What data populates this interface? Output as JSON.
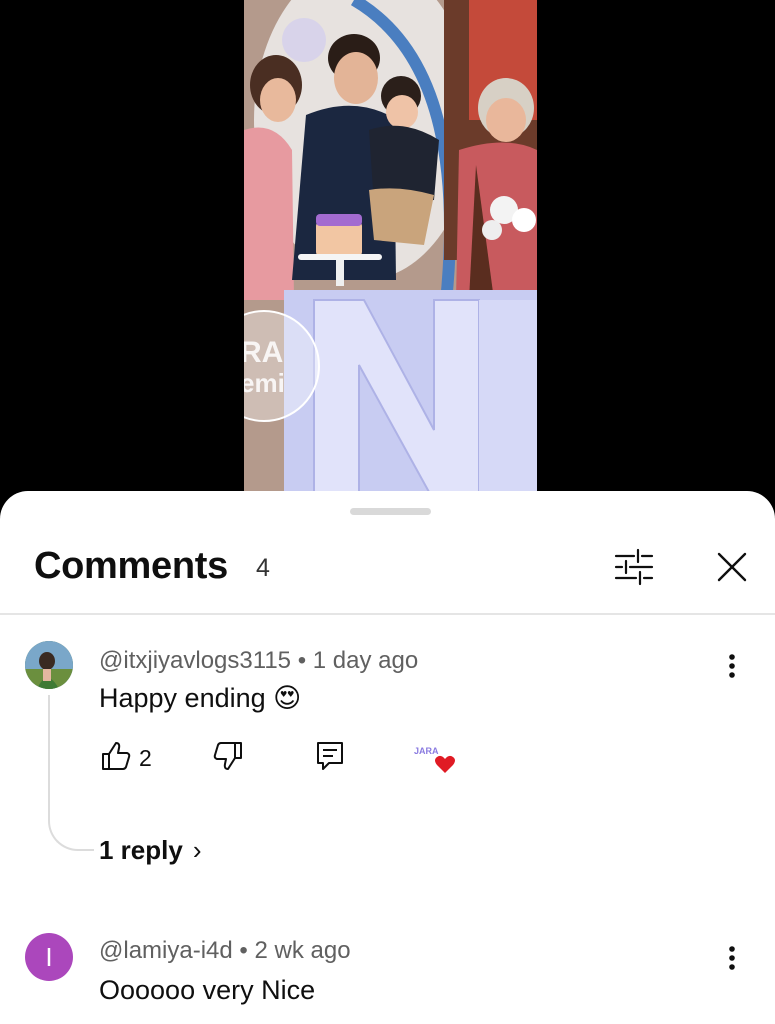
{
  "panel": {
    "title": "Comments",
    "count": "4"
  },
  "video": {
    "watermark": "JARA\nemi"
  },
  "comments": [
    {
      "author": "@itxjiyavlogs3115",
      "separator": "•",
      "time": "1 day ago",
      "text": "Happy ending",
      "emoji": "😍",
      "likes": "2",
      "creator_heart_badge": "JARA",
      "replies": "1 reply",
      "avatar_type": "photo"
    },
    {
      "author": "@lamiya-i4d",
      "separator": "•",
      "time": "2 wk ago",
      "text": "Oooooo very Nice",
      "avatar_letter": "I",
      "avatar_color": "#ab47bc",
      "avatar_type": "letter"
    }
  ],
  "icons": {
    "filter": "sliders-icon",
    "close": "close-icon",
    "like": "thumbs-up-icon",
    "dislike": "thumbs-down-icon",
    "reply": "reply-comment-icon",
    "more": "more-vert-icon",
    "heart": "creator-heart-icon",
    "chevron": "chevron-right-icon"
  }
}
